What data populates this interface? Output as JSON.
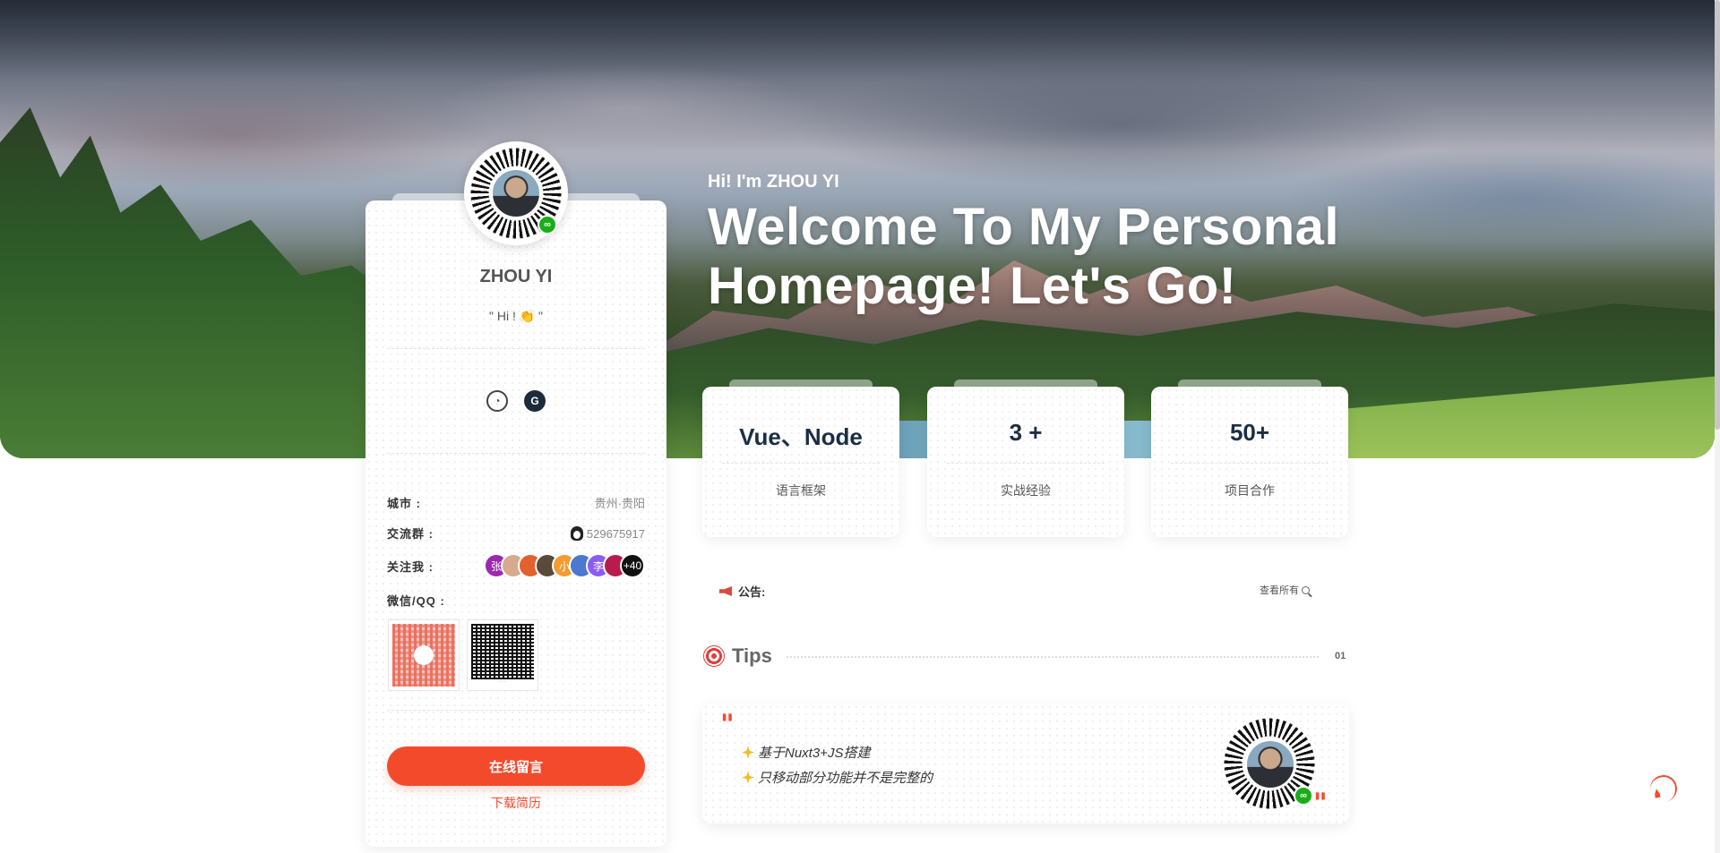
{
  "hero": {
    "greeting": "Hi! I'm ZHOU YI",
    "welcome": "Welcome To My Personal Homepage! Let's Go!"
  },
  "profile": {
    "name": "ZHOU YI",
    "motto": "\" Hi ! 👏 \"",
    "social_icons": [
      "github-icon",
      "gitee-icon"
    ],
    "city_label": "城市 :",
    "city_value": "贵州·贵阳",
    "group_label": "交流群 :",
    "group_value": "529675917",
    "follow_label": "关注我 :",
    "followers": [
      {
        "text": "张",
        "color": "#9c27b0"
      },
      {
        "text": "",
        "color": "#d7a98e"
      },
      {
        "text": "",
        "color": "#e2622d"
      },
      {
        "text": "",
        "color": "#5a4a3a"
      },
      {
        "text": "小",
        "color": "#f29b31"
      },
      {
        "text": "",
        "color": "#4b78d0"
      },
      {
        "text": "李",
        "color": "#8b5cf6"
      },
      {
        "text": "",
        "color": "#b91c4c"
      },
      {
        "text": "+40",
        "color": "#111111"
      }
    ],
    "contact_label": "微信/QQ :",
    "message_button": "在线留言",
    "download_link": "下载简历"
  },
  "stats": [
    {
      "value": "Vue、Node",
      "label": "语言框架"
    },
    {
      "value": "3 +",
      "label": "实战经验"
    },
    {
      "value": "50+",
      "label": "项目合作"
    }
  ],
  "notice": {
    "label": "公告:",
    "see_all": "查看所有"
  },
  "tips": {
    "title": "Tips",
    "page": "01",
    "lines": [
      "基于Nuxt3+JS搭建",
      "只移动部分功能并不是完整的"
    ]
  },
  "colors": {
    "accent": "#f44a2c",
    "heading": "#1b2e44"
  }
}
